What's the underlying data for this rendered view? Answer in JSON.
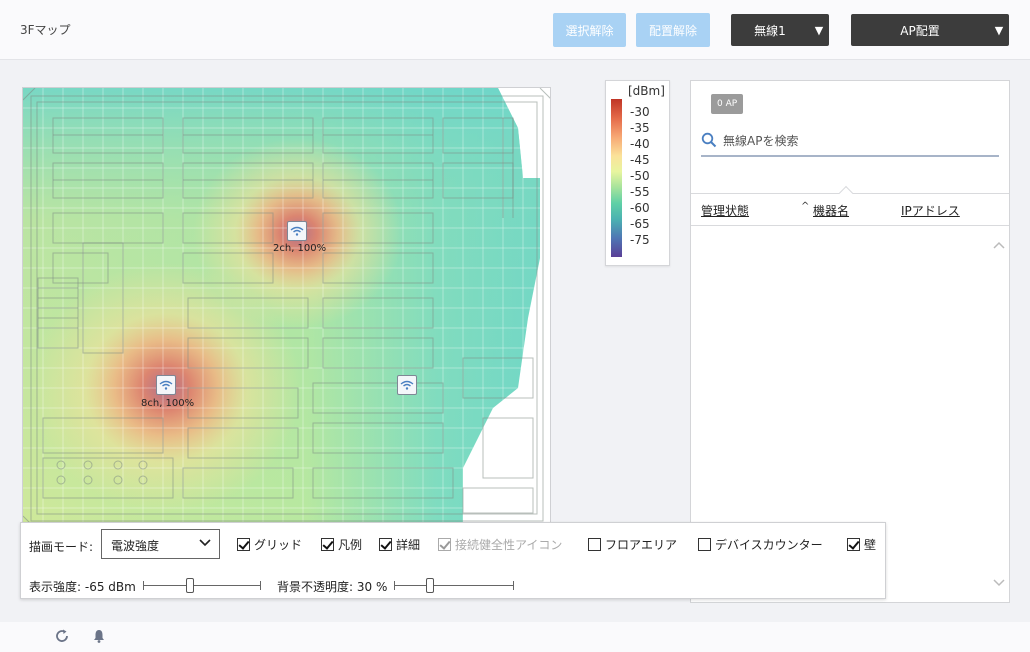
{
  "header": {
    "title": "3Fマップ",
    "deselect_label": "選択解除",
    "unplace_label": "配置解除",
    "radio_select": "無線1",
    "ap_placement": "AP配置"
  },
  "map": {
    "aps": [
      {
        "label": "2ch, 100%"
      },
      {
        "label": "8ch, 100%"
      },
      {
        "label": ""
      }
    ]
  },
  "legend": {
    "unit": "[dBm]",
    "ticks": [
      "-30",
      "-35",
      "-40",
      "-45",
      "-50",
      "-55",
      "-60",
      "-65",
      "-75"
    ]
  },
  "panel": {
    "ap_count": "0 AP",
    "search_placeholder": "無線APを検索",
    "columns": [
      "管理状態",
      "機器名",
      "IPアドレス"
    ],
    "sort_indicator": "^"
  },
  "controls": {
    "mode_label": "描画モード:",
    "mode_value": "電波強度",
    "checkboxes": [
      {
        "label": "グリッド",
        "checked": true
      },
      {
        "label": "凡例",
        "checked": true
      },
      {
        "label": "詳細",
        "checked": true
      },
      {
        "label": "接続健全性アイコン",
        "checked": true,
        "disabled": true
      },
      {
        "label": "フロアエリア",
        "checked": false
      },
      {
        "label": "デバイスカウンター",
        "checked": false
      },
      {
        "label": "壁",
        "checked": true
      }
    ],
    "strength_label": "表示強度: -65 dBm",
    "opacity_label": "背景不透明度: 30 %",
    "strength_fraction": 0.4,
    "opacity_fraction": 0.3
  },
  "colors": {
    "accent_light": "#a9d2f4",
    "dark_button": "#3c3c3c"
  }
}
